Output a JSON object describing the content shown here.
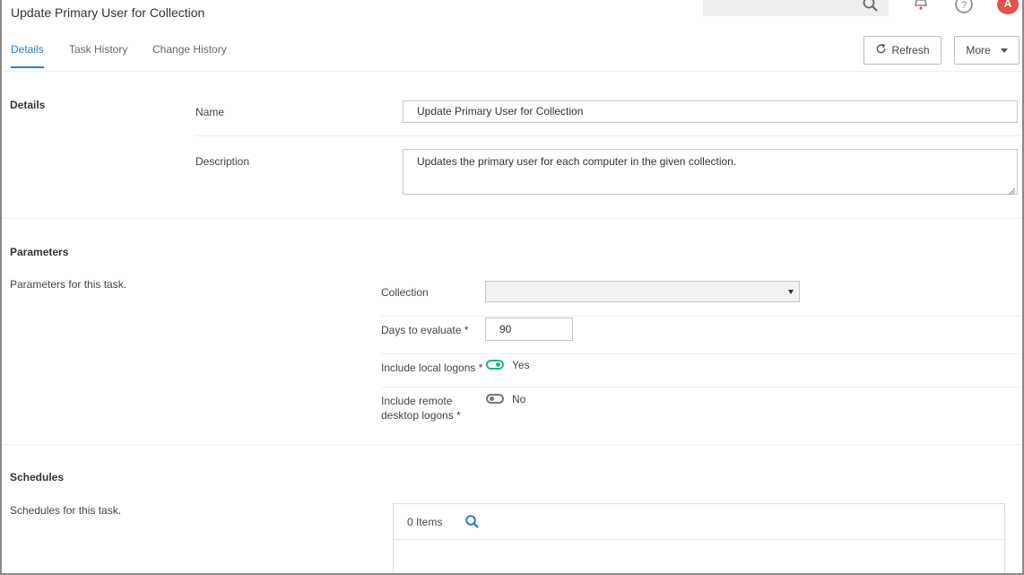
{
  "header": {
    "title": "Update Primary User for Collection",
    "avatar_initial": "A"
  },
  "tabs": [
    {
      "label": "Details",
      "active": true
    },
    {
      "label": "Task History",
      "active": false
    },
    {
      "label": "Change History",
      "active": false
    }
  ],
  "toolbar": {
    "refresh_label": "Refresh",
    "more_label": "More"
  },
  "details": {
    "section_title": "Details",
    "name_label": "Name",
    "name_value": "Update Primary User for Collection",
    "description_label": "Description",
    "description_value": "Updates the primary user for each computer in the given collection."
  },
  "parameters": {
    "section_title": "Parameters",
    "section_desc": "Parameters for this task.",
    "collection_label": "Collection",
    "collection_value": "",
    "days_label": "Days to evaluate *",
    "days_value": "90",
    "local_logons_label": "Include local logons *",
    "local_logons_value": "Yes",
    "local_logons_on": true,
    "remote_logons_label_line1": "Include remote",
    "remote_logons_label_line2": "desktop logons *",
    "remote_logons_value": "No",
    "remote_logons_on": false
  },
  "schedules": {
    "section_title": "Schedules",
    "section_desc": "Schedules for this task.",
    "items_count": "0 Items"
  },
  "colors": {
    "accent": "#2a7fc9",
    "toggle_on": "#20b58f",
    "avatar": "#e5524b"
  }
}
